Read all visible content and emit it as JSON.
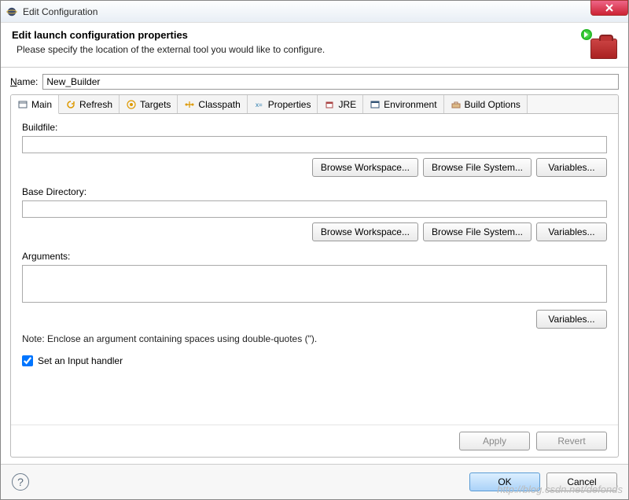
{
  "titlebar": {
    "title": "Edit Configuration"
  },
  "header": {
    "title": "Edit launch configuration properties",
    "subtitle": "Please specify the location of the external tool you would like to configure."
  },
  "name_row": {
    "label_pre": "N",
    "label_post": "ame:",
    "value": "New_Builder"
  },
  "tabs": {
    "main": "Main",
    "refresh": "Refresh",
    "targets": "Targets",
    "classpath": "Classpath",
    "properties": "Properties",
    "jre": "JRE",
    "environment": "Environment",
    "build_options": "Build Options"
  },
  "main_tab": {
    "buildfile_label": "Buildfile:",
    "buildfile_value": "",
    "base_dir_label": "Base Directory:",
    "base_dir_value": "",
    "arguments_label": "Arguments:",
    "arguments_value": "",
    "browse_workspace": "Browse Workspace...",
    "browse_filesystem": "Browse File System...",
    "variables": "Variables...",
    "note": "Note: Enclose an argument containing spaces using double-quotes (\").",
    "checkbox_label": "Set an Input handler",
    "checkbox_checked": true
  },
  "apply_row": {
    "apply": "Apply",
    "revert": "Revert"
  },
  "footer": {
    "ok": "OK",
    "cancel": "Cancel"
  },
  "watermark": "http://blog.csdn.net/defonds"
}
